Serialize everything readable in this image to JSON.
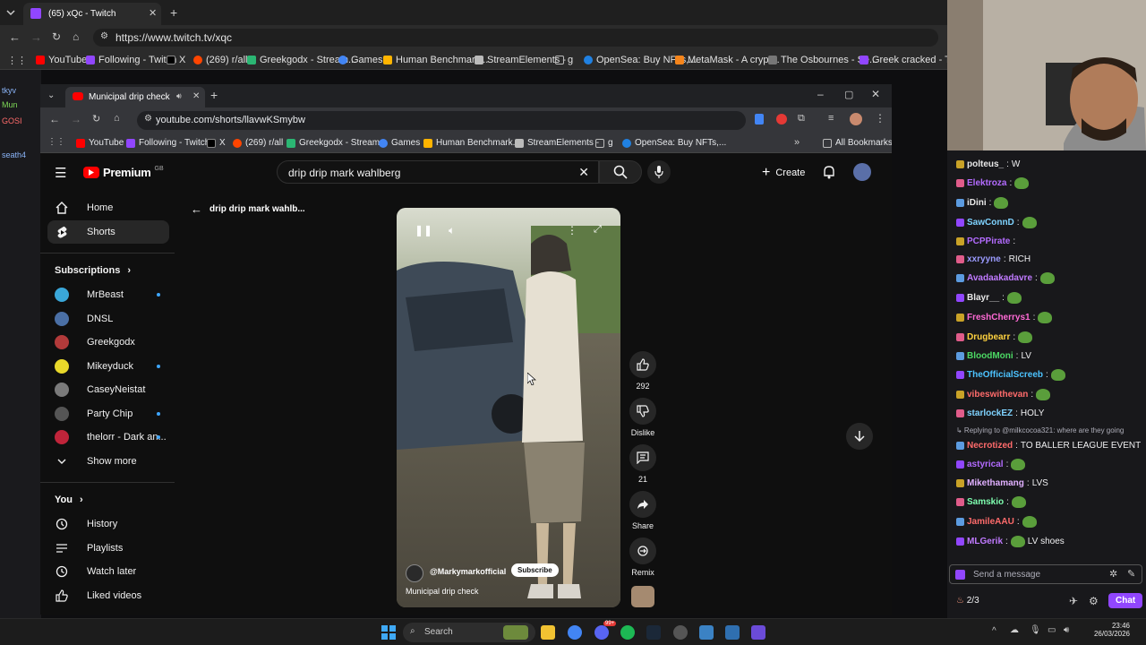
{
  "outer_browser": {
    "tab_title": "(65) xQc - Twitch",
    "url": "https://www.twitch.tv/xqc",
    "bookmarks": [
      "YouTube",
      "Following - Twitch",
      "X",
      "(269) r/all",
      "Greekgodx - Stream...",
      "Games",
      "Human Benchmark...",
      "StreamElements -",
      "g",
      "OpenSea: Buy NFTs,...",
      "MetaMask - A crypt...",
      "The Osbournes - Se...",
      "Greek cracked - Twi..."
    ]
  },
  "twitch_sidebar_names": [
    "tkyv",
    "Mun",
    "GOSI",
    "seath4"
  ],
  "inner_browser": {
    "tab_title": "Municipal drip check",
    "url": "youtube.com/shorts/llavwKSmybw",
    "bookmarks": [
      "YouTube",
      "Following - Twitch",
      "X",
      "(269) r/all",
      "Greekgodx - Stream...",
      "Games",
      "Human Benchmark...",
      "StreamElements -",
      "g",
      "OpenSea: Buy NFTs,..."
    ],
    "all_bookmarks": "All Bookmarks"
  },
  "youtube": {
    "logo": "Premium",
    "logo_region": "GB",
    "search_value": "drip drip mark wahlberg",
    "create_label": "Create",
    "back_label": "drip drip mark wahlb...",
    "nav": [
      {
        "label": "Home",
        "icon": "home-icon"
      },
      {
        "label": "Shorts",
        "icon": "shorts-icon"
      }
    ],
    "subscriptions_header": "Subscriptions",
    "subscriptions": [
      {
        "name": "MrBeast",
        "dot": true,
        "color": "#3aa7d9"
      },
      {
        "name": "DNSL",
        "dot": false,
        "color": "#4a6fa5"
      },
      {
        "name": "Greekgodx",
        "dot": false,
        "color": "#b23a3a"
      },
      {
        "name": "Mikeyduck",
        "dot": true,
        "color": "#e8d82a"
      },
      {
        "name": "CaseyNeistat",
        "dot": false,
        "color": "#7a7a7a"
      },
      {
        "name": "Party Chip",
        "dot": true,
        "color": "#555"
      },
      {
        "name": "thelorr - Dark an...",
        "dot": true,
        "color": "#c0243a"
      }
    ],
    "show_more": "Show more",
    "you_header": "You",
    "you_items": [
      {
        "label": "History",
        "icon": "history-icon"
      },
      {
        "label": "Playlists",
        "icon": "playlists-icon"
      },
      {
        "label": "Watch later",
        "icon": "watch-later-icon"
      },
      {
        "label": "Liked videos",
        "icon": "liked-videos-icon"
      }
    ],
    "short": {
      "channel": "@Markymarkofficial",
      "subscribe": "Subscribe",
      "title": "Municipal drip check",
      "likes": "292",
      "dislike_label": "Dislike",
      "comments": "21",
      "share_label": "Share",
      "remix_label": "Remix"
    }
  },
  "chat": {
    "messages": [
      {
        "user": "polteus_",
        "color": "#e8e8e8",
        "text": "W",
        "emote": false
      },
      {
        "user": "Elektroza",
        "color": "#b36bff",
        "text": "",
        "emote": true
      },
      {
        "user": "iDini",
        "color": "#e8e8e8",
        "text": "",
        "emote": true
      },
      {
        "user": "SawConnD",
        "color": "#7fd3ff",
        "text": "",
        "emote": true
      },
      {
        "user": "PCPPirate",
        "color": "#b36bff",
        "text": "",
        "emote": false
      },
      {
        "user": "xxryyne",
        "color": "#9b9bff",
        "text": "RICH",
        "emote": false
      },
      {
        "user": "Avadaakadavre",
        "color": "#c07aff",
        "text": "",
        "emote": true
      },
      {
        "user": "Blayr__",
        "color": "#e8e8e8",
        "text": "",
        "emote": true
      },
      {
        "user": "FreshCherrys1",
        "color": "#ff6ad5",
        "text": "",
        "emote": true
      },
      {
        "user": "Drugbearr",
        "color": "#ffd23f",
        "text": "",
        "emote": true
      },
      {
        "user": "BloodMoni",
        "color": "#4cd964",
        "text": "LV",
        "emote": false
      },
      {
        "user": "TheOfficialScreeb",
        "color": "#4cc3ff",
        "text": "",
        "emote": true
      },
      {
        "user": "vibeswithevan",
        "color": "#ff6b6b",
        "text": "",
        "emote": true
      },
      {
        "user": "starlockEZ",
        "color": "#7fd3ff",
        "text": "HOLY",
        "emote": false
      },
      {
        "user": "Necrotized",
        "color": "#ff6b6b",
        "text": "TO BALLER LEAGUE EVENT",
        "emote": false,
        "reply": "Replying to @milkcocoa321: where are they going"
      },
      {
        "user": "astyrical",
        "color": "#b36bff",
        "text": "",
        "emote": true
      },
      {
        "user": "Mikethamang",
        "color": "#e0b0ff",
        "text": "LVS",
        "emote": false
      },
      {
        "user": "Samskio",
        "color": "#7fffb0",
        "text": "",
        "emote": true
      },
      {
        "user": "JamileAAU",
        "color": "#ff6b6b",
        "text": "",
        "emote": true
      },
      {
        "user": "MLGerik",
        "color": "#c07aff",
        "text": "LV shoes",
        "emote": true
      }
    ],
    "input_placeholder": "Send a message",
    "points": "2/3",
    "chat_button": "Chat"
  },
  "taskbar": {
    "search": "Search",
    "time": "23:46",
    "date": "26/03/2026",
    "badge": "99+"
  }
}
